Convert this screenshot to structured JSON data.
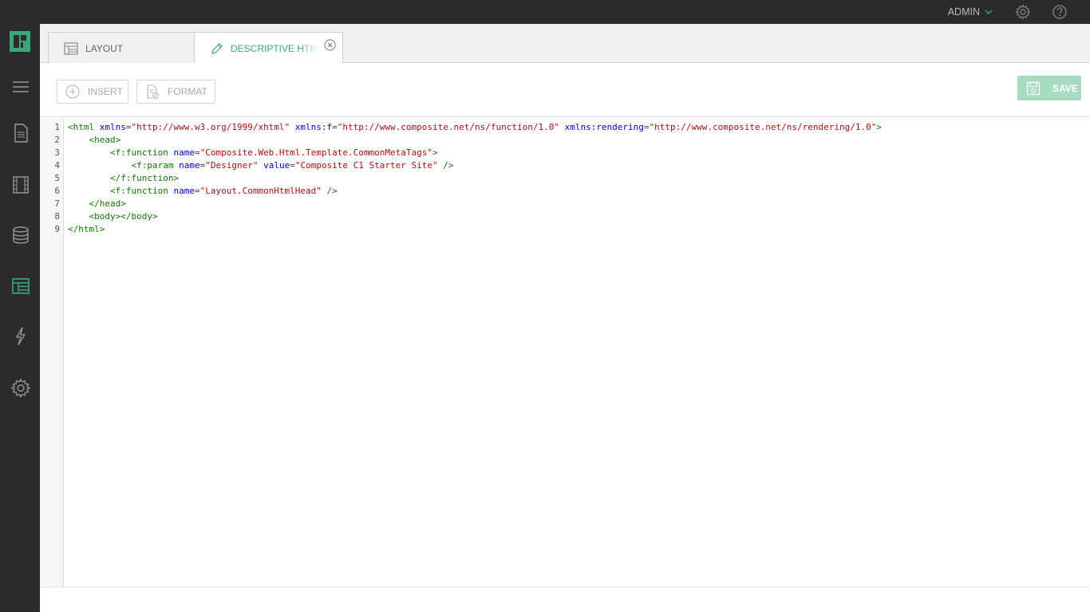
{
  "header": {
    "user_label": "ADMIN",
    "icons": [
      "chevron-down-icon",
      "settings-gear-icon",
      "help-circle-icon"
    ]
  },
  "rail": {
    "items": [
      {
        "name": "menu-icon"
      },
      {
        "name": "content-pages-icon"
      },
      {
        "name": "media-icon"
      },
      {
        "name": "data-icon"
      },
      {
        "name": "layout-icon",
        "active": true
      },
      {
        "name": "functions-icon"
      },
      {
        "name": "system-settings-icon"
      }
    ]
  },
  "tabs": [
    {
      "label": "LAYOUT",
      "icon": "layout-icon",
      "active": false
    },
    {
      "label": "DESCRIPTIVE HTML LAYOUT",
      "icon": "pencil-icon",
      "active": true,
      "close_icon": "close-circle-icon"
    }
  ],
  "toolbar": {
    "insert_label": "INSERT",
    "format_label": "FORMAT",
    "save_label": "SAVE"
  },
  "colors": {
    "accent": "#3aa876",
    "save_bg": "#a7dcc1",
    "chrome": "#2b2b2b"
  },
  "editor": {
    "line_numbers": [
      "1",
      "2",
      "3",
      "4",
      "5",
      "6",
      "7",
      "8",
      "9"
    ],
    "lines": [
      [
        {
          "k": "t",
          "s": "<html "
        },
        {
          "k": "a",
          "s": "xmlns"
        },
        {
          "k": "p",
          "s": "="
        },
        {
          "k": "v",
          "s": "\"http://www.w3.org/1999/xhtml\""
        },
        {
          "k": "p",
          "s": " "
        },
        {
          "k": "a",
          "s": "xmlns:f"
        },
        {
          "k": "p",
          "s": "="
        },
        {
          "k": "v",
          "s": "\"http://www.composite.net/ns/function/1.0\""
        },
        {
          "k": "p",
          "s": " "
        },
        {
          "k": "a",
          "s": "xmlns:rendering"
        },
        {
          "k": "p",
          "s": "="
        },
        {
          "k": "v",
          "s": "\"http://www.composite.net/ns/rendering/1.0\""
        },
        {
          "k": "t",
          "s": ">"
        }
      ],
      [
        {
          "k": "p",
          "s": "    "
        },
        {
          "k": "t",
          "s": "<head>"
        }
      ],
      [
        {
          "k": "p",
          "s": "        "
        },
        {
          "k": "t",
          "s": "<f:function "
        },
        {
          "k": "a",
          "s": "name"
        },
        {
          "k": "p",
          "s": "="
        },
        {
          "k": "v",
          "s": "\"Composite.Web.Html.Template.CommonMetaTags\""
        },
        {
          "k": "t",
          "s": ">"
        }
      ],
      [
        {
          "k": "p",
          "s": "            "
        },
        {
          "k": "t",
          "s": "<f:param "
        },
        {
          "k": "a",
          "s": "name"
        },
        {
          "k": "p",
          "s": "="
        },
        {
          "k": "v",
          "s": "\"Designer\""
        },
        {
          "k": "p",
          "s": " "
        },
        {
          "k": "a",
          "s": "value"
        },
        {
          "k": "p",
          "s": "="
        },
        {
          "k": "v",
          "s": "\"Composite C1 Starter Site\""
        },
        {
          "k": "t",
          "s": " />"
        }
      ],
      [
        {
          "k": "p",
          "s": "        "
        },
        {
          "k": "t",
          "s": "</f:function>"
        }
      ],
      [
        {
          "k": "p",
          "s": "        "
        },
        {
          "k": "t",
          "s": "<f:function "
        },
        {
          "k": "a",
          "s": "name"
        },
        {
          "k": "p",
          "s": "="
        },
        {
          "k": "v",
          "s": "\"Layout.CommonHtmlHead\""
        },
        {
          "k": "t",
          "s": " />"
        }
      ],
      [
        {
          "k": "p",
          "s": "    "
        },
        {
          "k": "t",
          "s": "</head>"
        }
      ],
      [
        {
          "k": "p",
          "s": "    "
        },
        {
          "k": "t",
          "s": "<body></body>"
        }
      ],
      [
        {
          "k": "t",
          "s": "</html>"
        }
      ]
    ]
  }
}
